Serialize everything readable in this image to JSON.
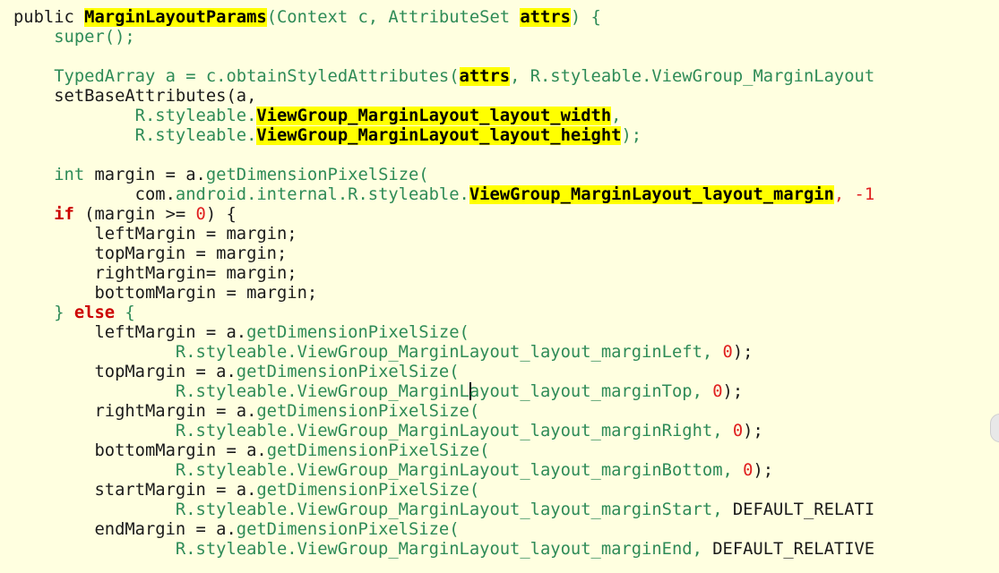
{
  "colors": {
    "background": "#ffffe0",
    "highlight": "#ffff00",
    "keyword": "#cc0000",
    "method": "#2e8b57",
    "number": "#e02020",
    "plain": "#1a1a1a"
  },
  "lines": [
    [
      {
        "t": "public ",
        "c": "p"
      },
      {
        "t": "MarginLayoutParams",
        "c": "hl"
      },
      {
        "t": "(Context c, AttributeSet ",
        "c": "t"
      },
      {
        "t": "attrs",
        "c": "hl"
      },
      {
        "t": ") {",
        "c": "t"
      }
    ],
    [
      {
        "t": "    super",
        "c": "m"
      },
      {
        "t": "();",
        "c": "t"
      }
    ],
    [],
    [
      {
        "t": "    TypedArray a = c.obtainStyledAttributes(",
        "c": "t"
      },
      {
        "t": "attrs",
        "c": "hl"
      },
      {
        "t": ", R.styleable.ViewGroup_MarginLayout",
        "c": "t"
      }
    ],
    [
      {
        "t": "    setBaseAttributes(a,",
        "c": "p"
      }
    ],
    [
      {
        "t": "            R.styleable.",
        "c": "t"
      },
      {
        "t": "ViewGroup_MarginLayout_layout_width",
        "c": "hl"
      },
      {
        "t": ",",
        "c": "t"
      }
    ],
    [
      {
        "t": "            R.styleable.",
        "c": "t"
      },
      {
        "t": "ViewGroup_MarginLayout_layout_height",
        "c": "hl"
      },
      {
        "t": ");",
        "c": "t"
      }
    ],
    [],
    [
      {
        "t": "    int ",
        "c": "t"
      },
      {
        "t": "margin = a.",
        "c": "p"
      },
      {
        "t": "getDimensionPixelSize(",
        "c": "m"
      }
    ],
    [
      {
        "t": "            com.",
        "c": "p"
      },
      {
        "t": "android.internal.R.styleable.",
        "c": "t"
      },
      {
        "t": "ViewGroup_MarginLayout_layout_margin",
        "c": "hl"
      },
      {
        "t": ", -1",
        "c": "n"
      }
    ],
    [
      {
        "t": "    ",
        "c": "p"
      },
      {
        "t": "if",
        "c": "kr"
      },
      {
        "t": " (margin >= ",
        "c": "p"
      },
      {
        "t": "0",
        "c": "n"
      },
      {
        "t": ") {",
        "c": "p"
      }
    ],
    [
      {
        "t": "        leftMargin = margin;",
        "c": "p"
      }
    ],
    [
      {
        "t": "        topMargin = margin;",
        "c": "p"
      }
    ],
    [
      {
        "t": "        rightMargin= margin;",
        "c": "p"
      }
    ],
    [
      {
        "t": "        bottomMargin = margin;",
        "c": "p"
      }
    ],
    [
      {
        "t": "    } ",
        "c": "t"
      },
      {
        "t": "else",
        "c": "kr"
      },
      {
        "t": " {",
        "c": "t"
      }
    ],
    [
      {
        "t": "        leftMargin = a.",
        "c": "p"
      },
      {
        "t": "getDimensionPixelSize(",
        "c": "m"
      }
    ],
    [
      {
        "t": "                R.styleable.ViewGroup_MarginLayout_layout_marginLeft, ",
        "c": "t"
      },
      {
        "t": "0",
        "c": "n"
      },
      {
        "t": ");",
        "c": "p"
      }
    ],
    [
      {
        "t": "        topMargin = a.",
        "c": "p"
      },
      {
        "t": "getDimensionPixelSize(",
        "c": "m"
      }
    ],
    [
      {
        "t": "                R.styleable.ViewGroup_MarginL",
        "c": "t"
      },
      {
        "t": "",
        "c": "caret"
      },
      {
        "t": "ayout_layout_marginTop, ",
        "c": "t"
      },
      {
        "t": "0",
        "c": "n"
      },
      {
        "t": ");",
        "c": "p"
      }
    ],
    [
      {
        "t": "        rightMargin = a.",
        "c": "p"
      },
      {
        "t": "getDimensionPixelSize(",
        "c": "m"
      }
    ],
    [
      {
        "t": "                R.styleable.ViewGroup_MarginLayout_layout_marginRight, ",
        "c": "t"
      },
      {
        "t": "0",
        "c": "n"
      },
      {
        "t": ");",
        "c": "p"
      }
    ],
    [
      {
        "t": "        bottomMargin = a.",
        "c": "p"
      },
      {
        "t": "getDimensionPixelSize(",
        "c": "m"
      }
    ],
    [
      {
        "t": "                R.styleable.ViewGroup_MarginLayout_layout_marginBottom, ",
        "c": "t"
      },
      {
        "t": "0",
        "c": "n"
      },
      {
        "t": ");",
        "c": "p"
      }
    ],
    [
      {
        "t": "        startMargin = a.",
        "c": "p"
      },
      {
        "t": "getDimensionPixelSize(",
        "c": "m"
      }
    ],
    [
      {
        "t": "                R.styleable.ViewGroup_MarginLayout_layout_marginStart, ",
        "c": "t"
      },
      {
        "t": "DEFAULT_RELATI",
        "c": "p"
      }
    ],
    [
      {
        "t": "        endMargin = a.",
        "c": "p"
      },
      {
        "t": "getDimensionPixelSize(",
        "c": "m"
      }
    ],
    [
      {
        "t": "                R.styleable.ViewGroup_MarginLayout_layout_marginEnd, ",
        "c": "t"
      },
      {
        "t": "DEFAULT_RELATIVE",
        "c": "p"
      }
    ]
  ]
}
